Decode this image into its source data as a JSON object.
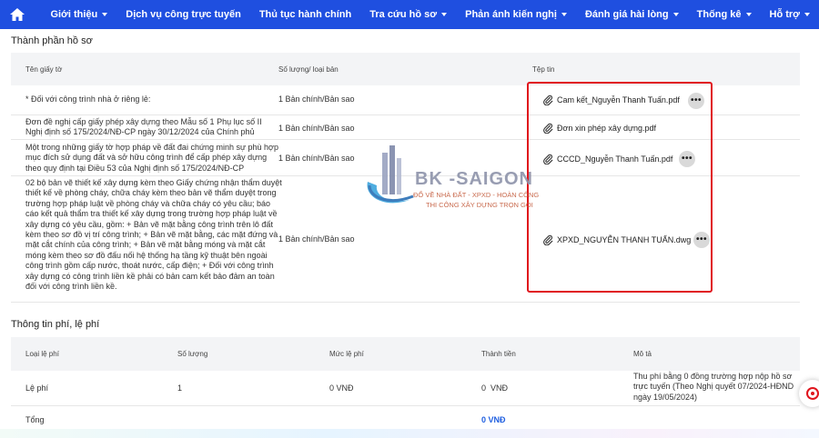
{
  "nav": {
    "items": [
      {
        "label": "Giới thiệu",
        "dropdown": true
      },
      {
        "label": "Dịch vụ công trực tuyến",
        "dropdown": false
      },
      {
        "label": "Thủ tục hành chính",
        "dropdown": false
      },
      {
        "label": "Tra cứu hồ sơ",
        "dropdown": true
      },
      {
        "label": "Phản ánh kiến nghị",
        "dropdown": true
      },
      {
        "label": "Đánh giá hài lòng",
        "dropdown": true
      },
      {
        "label": "Thống kê",
        "dropdown": true
      },
      {
        "label": "Hỗ trợ",
        "dropdown": true
      }
    ]
  },
  "documents": {
    "title": "Thành phần hồ sơ",
    "headers": {
      "name": "Tên giấy tờ",
      "quantity": "Số lượng/ loại bản",
      "files": "Tệp tin"
    },
    "rows": [
      {
        "name": "* Đối với công trình nhà ở riêng lẻ:",
        "quantity": "1 Bản chính/Bản sao",
        "file": "Cam kết_Nguyễn Thanh Tuấn.pdf",
        "has_menu": true
      },
      {
        "name": "Đơn đề nghị cấp giấy phép xây dựng theo Mẫu số 1 Phụ lục số II Nghị định số 175/2024/NĐ-CP ngày 30/12/2024 của Chính phủ",
        "quantity": "1 Bản chính/Bản sao",
        "file": "Đơn xin phép xây dựng.pdf",
        "has_menu": false
      },
      {
        "name": "Một trong những giấy tờ hợp pháp về đất đai chứng minh sự phù hợp mục đích sử dụng đất và sở hữu công trình để cấp phép xây dựng theo quy định tại Điều 53 của Nghị định số 175/2024/NĐ-CP",
        "quantity": "1 Bản chính/Bản sao",
        "file": "CCCD_Nguyễn Thanh Tuấn.pdf",
        "has_menu": true
      },
      {
        "name": "02 bộ bản vẽ thiết kế xây dựng kèm theo Giấy chứng nhận thẩm duyệt thiết kế về phòng cháy, chữa cháy kèm theo bản vẽ thẩm duyệt trong trường hợp pháp luật về phòng cháy và chữa cháy có yêu cầu; báo cáo kết quả thẩm tra thiết kế xây dựng trong trường hợp pháp luật về xây dựng có yêu cầu, gồm: + Bản vẽ mặt bằng công trình trên lô đất kèm theo sơ đồ vị trí công trình; + Bản vẽ mặt bằng, các mặt đứng và mặt cắt chính của công trình; + Bản vẽ mặt bằng móng và mặt cắt móng kèm theo sơ đồ đấu nối hệ thống hạ tầng kỹ thuật bên ngoài công trình gồm cấp nước, thoát nước, cấp điện; + Đối với công trình xây dựng có công trình liền kề phải có bản cam kết bảo đảm an toàn đối với công trình liền kề.",
        "quantity": "1 Bản chính/Bản sao",
        "file": "XPXD_NGUYỄN THANH TUẤN.dwg",
        "has_menu": true
      }
    ]
  },
  "fees": {
    "title": "Thông tin phí, lệ phí",
    "headers": {
      "type": "Loại lệ phí",
      "count": "Số lượng",
      "level": "Mức lệ phí",
      "amount": "Thành tiền",
      "desc": "Mô tả"
    },
    "row": {
      "type": "Lệ phí",
      "count": "1",
      "level": "0 VNĐ",
      "amount": "0  VNĐ",
      "desc": "Thu phí bằng 0 đồng trường hợp nộp hồ sơ trực tuyến (Theo Nghị quyết 07/2024-HĐND ngày 19/05/2024)"
    },
    "total_label": "Tổng",
    "total_value": "0 VNĐ",
    "total_color": "#1f5fe0"
  },
  "watermark": {
    "title": "BK -SAIGON",
    "line1": "ĐỔ VỀ NHÀ ĐẤT - XPXD - HOÀN CÔNG",
    "line2": "THI CÔNG XÂY DỰNG TRỌN GÓI"
  },
  "colors": {
    "nav_bg": "#1f4fe0",
    "highlight_border": "#e0141c"
  }
}
